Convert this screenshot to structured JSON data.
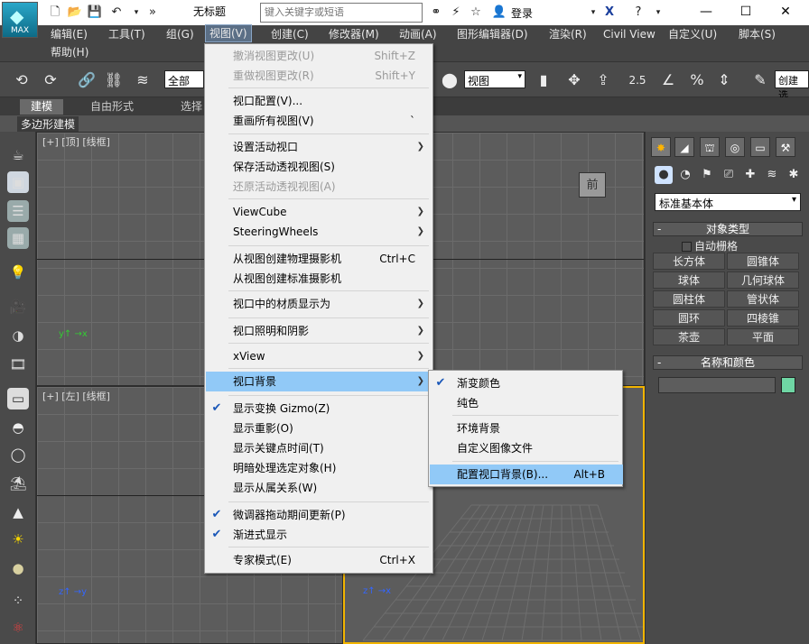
{
  "app": {
    "title": "无标题",
    "logo_text": "MAX",
    "search_placeholder": "键入关键字或短语",
    "login_label": "登录",
    "window_min": "—",
    "window_max": "☐",
    "window_close": "✕"
  },
  "menubar": {
    "items": [
      "编辑(E)",
      "工具(T)",
      "组(G)",
      "视图(V)",
      "创建(C)",
      "修改器(M)",
      "动画(A)",
      "图形编辑器(D)",
      "渲染(R)",
      "Civil View",
      "自定义(U)",
      "脚本(S)"
    ],
    "help": "帮助(H)"
  },
  "toolbar": {
    "selection_set": "全部",
    "view_ref": "视图",
    "create_selection": "创建选"
  },
  "ribbon": {
    "tabs": [
      "建模",
      "自由形式",
      "选择"
    ],
    "subpanel": "多边形建模"
  },
  "viewports": {
    "top_left": "[+] [顶] [线框]",
    "bottom_left": "[+] [左] [线框]",
    "cube_label": "前"
  },
  "view_menu": {
    "items": [
      {
        "label": "撤消视图更改(U)",
        "shortcut": "Shift+Z",
        "disabled": true
      },
      {
        "label": "重做视图更改(R)",
        "shortcut": "Shift+Y",
        "disabled": true
      },
      {
        "label": "视口配置(V)..."
      },
      {
        "label": "重画所有视图(V)",
        "shortcut": "`"
      },
      {
        "label": "设置活动视口",
        "submenu": true
      },
      {
        "label": "保存活动透视视图(S)"
      },
      {
        "label": "还原活动透视视图(A)",
        "disabled": true
      },
      {
        "label": "ViewCube",
        "submenu": true
      },
      {
        "label": "SteeringWheels",
        "submenu": true
      },
      {
        "label": "从视图创建物理摄影机",
        "shortcut": "Ctrl+C"
      },
      {
        "label": "从视图创建标准摄影机"
      },
      {
        "label": "视口中的材质显示为",
        "submenu": true
      },
      {
        "label": "视口照明和阴影",
        "submenu": true
      },
      {
        "label": "xView",
        "submenu": true
      },
      {
        "label": "视口背景",
        "submenu": true,
        "highlighted": true
      },
      {
        "label": "显示变换 Gizmo(Z)",
        "checked": true
      },
      {
        "label": "显示重影(O)"
      },
      {
        "label": "显示关键点时间(T)"
      },
      {
        "label": "明暗处理选定对象(H)"
      },
      {
        "label": "显示从属关系(W)"
      },
      {
        "label": "微调器拖动期间更新(P)",
        "checked": true
      },
      {
        "label": "渐进式显示",
        "checked": true
      },
      {
        "label": "专家模式(E)",
        "shortcut": "Ctrl+X"
      }
    ]
  },
  "bg_submenu": {
    "items": [
      {
        "label": "渐变颜色",
        "checked": true
      },
      {
        "label": "纯色"
      },
      {
        "label": "环境背景"
      },
      {
        "label": "自定义图像文件"
      },
      {
        "label": "配置视口背景(B)...",
        "shortcut": "Alt+B",
        "highlighted": true
      }
    ]
  },
  "command_panel": {
    "category": "标准基本体",
    "object_type_header": "对象类型",
    "autogrid": "自动栅格",
    "object_buttons": [
      "长方体",
      "圆锥体",
      "球体",
      "几何球体",
      "圆柱体",
      "管状体",
      "圆环",
      "四棱锥",
      "茶壶",
      "平面"
    ],
    "name_color_header": "名称和颜色",
    "swatch_color": "#6fd6a4"
  },
  "colors": {
    "menu_bg": "#f0f0f0",
    "highlight": "#91c9f7",
    "check": "#1a57b8"
  }
}
